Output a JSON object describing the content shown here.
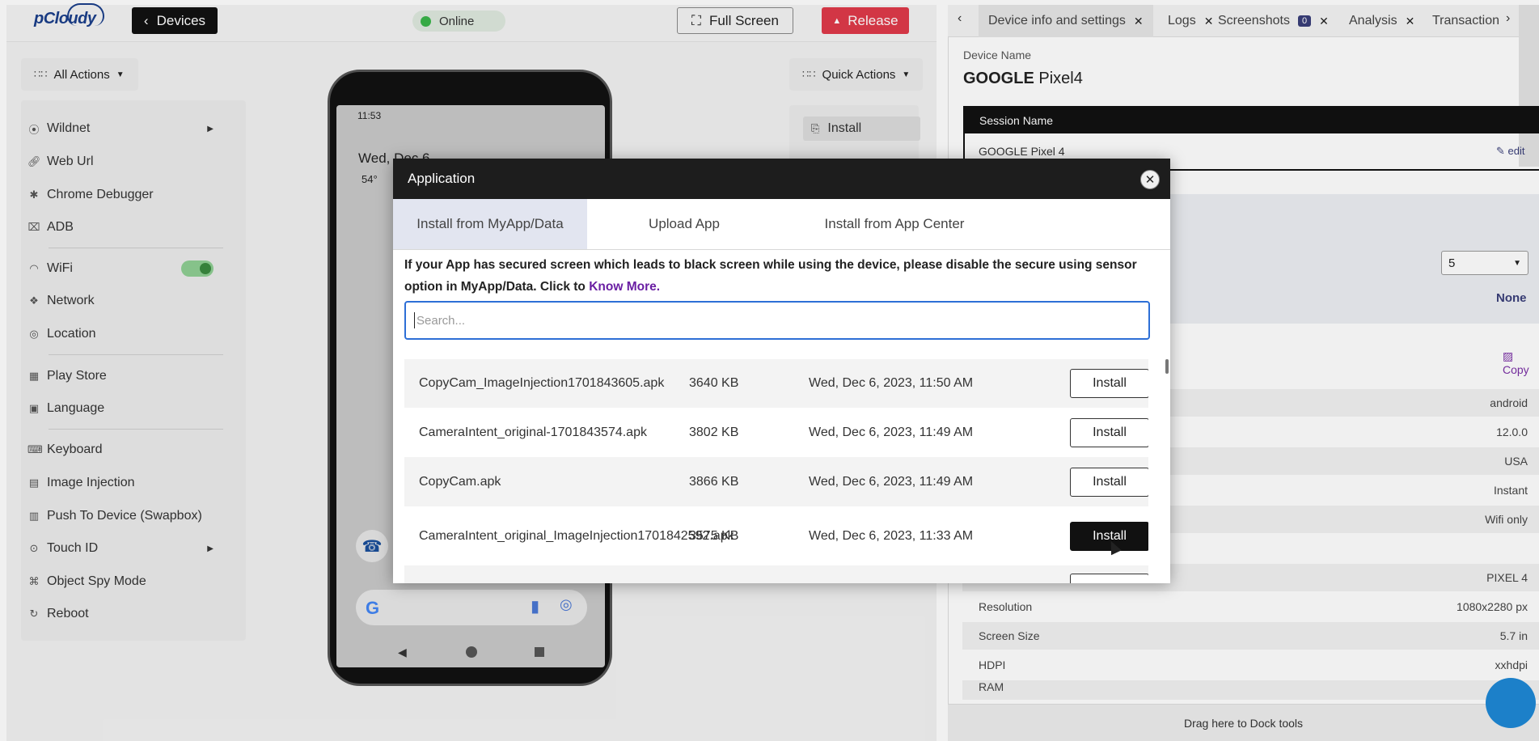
{
  "topbar": {
    "logo": "pCloudy",
    "devices_label": "Devices",
    "status_label": "Online",
    "fullscreen_label": "Full Screen",
    "release_label": "Release"
  },
  "left": {
    "all_actions_label": "All Actions",
    "tools": [
      {
        "label": "Wildnet",
        "icon": "wildnet-icon"
      },
      {
        "label": "Web Url",
        "icon": "link-icon"
      },
      {
        "label": "Chrome Debugger",
        "icon": "bug-icon"
      },
      {
        "label": "ADB",
        "icon": "terminal-icon"
      },
      {
        "label": "WiFi",
        "icon": "wifi-icon"
      },
      {
        "label": "Network",
        "icon": "network-icon"
      },
      {
        "label": "Location",
        "icon": "location-icon"
      },
      {
        "label": "Play Store",
        "icon": "store-icon"
      },
      {
        "label": "Language",
        "icon": "language-icon"
      },
      {
        "label": "Keyboard",
        "icon": "keyboard-icon"
      },
      {
        "label": "Image Injection",
        "icon": "image-icon"
      },
      {
        "label": "Push To Device (Swapbox)",
        "icon": "push-icon"
      },
      {
        "label": "Touch ID",
        "icon": "fingerprint-icon"
      },
      {
        "label": "Object Spy Mode",
        "icon": "spy-icon"
      },
      {
        "label": "Reboot",
        "icon": "reboot-icon"
      }
    ]
  },
  "phone": {
    "time": "11:53",
    "date": "Wed, Dec 6",
    "temp": "54°"
  },
  "quick": {
    "label": "Quick Actions",
    "install_label": "Install"
  },
  "right": {
    "tabs": [
      {
        "label": "Device info and settings"
      },
      {
        "label": "Logs"
      },
      {
        "label": "Screenshots",
        "badge": "0"
      },
      {
        "label": "Analysis"
      },
      {
        "label": "Transaction"
      }
    ],
    "device_name_label": "Device Name",
    "device_brand": "GOOGLE",
    "device_model": "Pixel4",
    "session_name_label": "Session Name",
    "session_name_value": "GOOGLE Pixel 4",
    "edit_label": "edit",
    "select_value": "5",
    "none_label": "None",
    "copy_label": "Copy",
    "info_rows": [
      {
        "label": "",
        "value": "android"
      },
      {
        "label": "",
        "value": "12.0.0"
      },
      {
        "label": "",
        "value": "USA"
      },
      {
        "label": "",
        "value": "Instant"
      },
      {
        "label": "",
        "value": "Wifi only"
      },
      {
        "label": "",
        "value": ""
      },
      {
        "label": "",
        "value": "PIXEL 4"
      },
      {
        "label": "Resolution",
        "value": "1080x2280 px"
      },
      {
        "label": "Screen Size",
        "value": "5.7 in"
      },
      {
        "label": "HDPI",
        "value": "xxhdpi"
      },
      {
        "label": "RAM",
        "value": ""
      }
    ],
    "dock_label": "Drag here to Dock tools"
  },
  "modal": {
    "title": "Application",
    "tabs": [
      "Install from MyApp/Data",
      "Upload App",
      "Install from App Center"
    ],
    "notice_text": "If your App has secured screen which leads to black screen while using the device, please disable the secure using sensor option in MyApp/Data. Click to ",
    "notice_link": "Know More.",
    "search_placeholder": "Search...",
    "apps": [
      {
        "name": "CopyCam_ImageInjection1701843605.apk",
        "size": "3640 KB",
        "date": "Wed, Dec 6, 2023, 11:50 AM",
        "action": "Install"
      },
      {
        "name": "CameraIntent_original-1701843574.apk",
        "size": "3802 KB",
        "date": "Wed, Dec 6, 2023, 11:49 AM",
        "action": "Install"
      },
      {
        "name": "CopyCam.apk",
        "size": "3866 KB",
        "date": "Wed, Dec 6, 2023, 11:49 AM",
        "action": "Install"
      },
      {
        "name": "CameraIntent_original_ImageInjection1701842592.apk",
        "size": "3575 KB",
        "date": "Wed, Dec 6, 2023, 11:33 AM",
        "action": "Install"
      }
    ]
  },
  "colors": {
    "accent": "#2d6fd6",
    "link": "#6a1fa3",
    "online": "#3ab54a",
    "release": "#e03a4a",
    "modal_header": "#1d1d1d"
  }
}
